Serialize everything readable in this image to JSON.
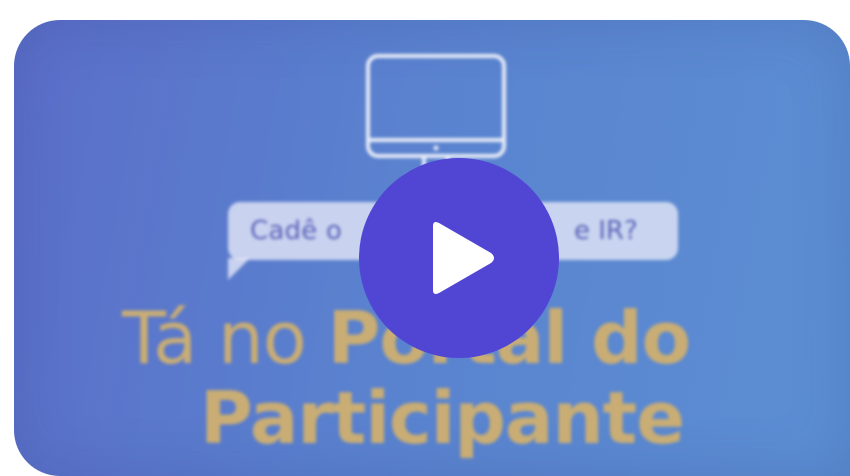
{
  "video": {
    "bubble_text_left": "Cadê o",
    "bubble_text_right": "e IR?",
    "headline_word_1": "Tá no ",
    "headline_word_2": "Portal do",
    "headline_line_2": "Participante"
  },
  "play_button": {
    "icon": "play-icon",
    "color": "#5146d4"
  },
  "colors": {
    "background_start": "#5b6ec9",
    "background_end": "#5c8fd3",
    "headline": "#c9ad74",
    "bubble_text": "#5b63b8"
  }
}
